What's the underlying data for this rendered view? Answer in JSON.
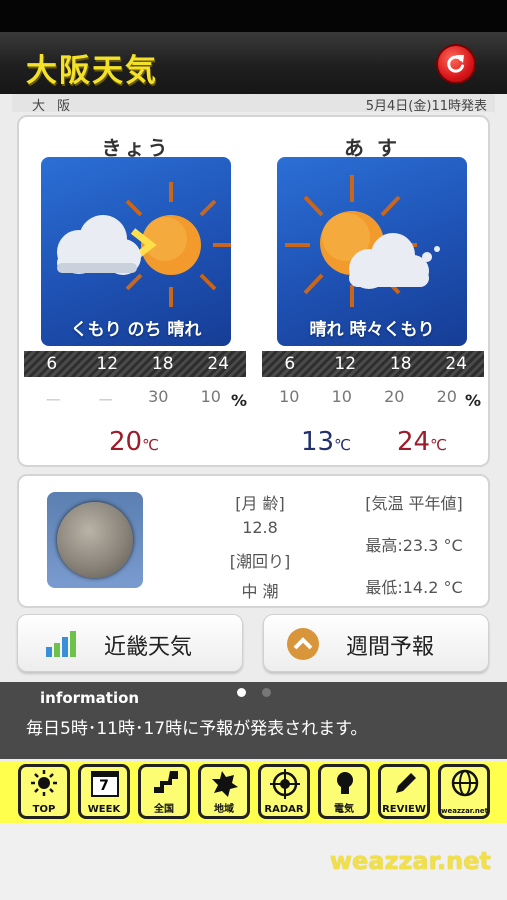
{
  "header": {
    "title": "大阪天気",
    "refresh_icon": "refresh-icon"
  },
  "subheader": {
    "city": "大 阪",
    "issued": "5月4日(金)11時発表"
  },
  "forecast": {
    "days": [
      {
        "label": "きょう",
        "weather": "くもり のち 晴れ",
        "hours": [
          "6",
          "12",
          "18",
          "24"
        ],
        "rain": [
          "ー",
          "ー",
          "30",
          "10"
        ],
        "rain_unit": "%",
        "temp_max": "20",
        "temp_unit": "℃"
      },
      {
        "label": "あ す",
        "weather": "晴れ 時々くもり",
        "hours": [
          "6",
          "12",
          "18",
          "24"
        ],
        "rain": [
          "10",
          "10",
          "20",
          "20"
        ],
        "rain_unit": "%",
        "temp_min": "13",
        "temp_max": "24",
        "temp_unit": "℃"
      }
    ]
  },
  "moon": {
    "age_label": "[月 齢]",
    "age": "12.8",
    "tide_label": "[潮回り]",
    "tide": "中 潮",
    "normal_label": "[気温 平年値]",
    "normal_high": "最高:23.3 °C",
    "normal_low": "最低:14.2 °C"
  },
  "buttons": {
    "regional": "近畿天気",
    "weekly": "週間予報"
  },
  "info": {
    "title": "information",
    "message": "毎日5時･11時･17時に予報が発表されます。",
    "page": 1,
    "pages": 2
  },
  "nav": [
    {
      "label": "TOP",
      "icon": "sun-icon"
    },
    {
      "label": "WEEK",
      "icon": "calendar-icon",
      "badge": "7"
    },
    {
      "label": "全国",
      "icon": "japan-map-icon"
    },
    {
      "label": "地域",
      "icon": "region-map-icon"
    },
    {
      "label": "RADAR",
      "icon": "radar-icon"
    },
    {
      "label": "電気",
      "icon": "lightbulb-icon"
    },
    {
      "label": "REVIEW",
      "icon": "pencil-icon"
    },
    {
      "label": "weazzar.net",
      "icon": "globe-icon"
    }
  ],
  "footer": {
    "brand": "weazzar.net"
  },
  "colors": {
    "title_yellow": "#f3e12a",
    "nav_yellow": "#ffff4e",
    "temp_red": "#9b1d2c",
    "temp_blue": "#22306d"
  }
}
